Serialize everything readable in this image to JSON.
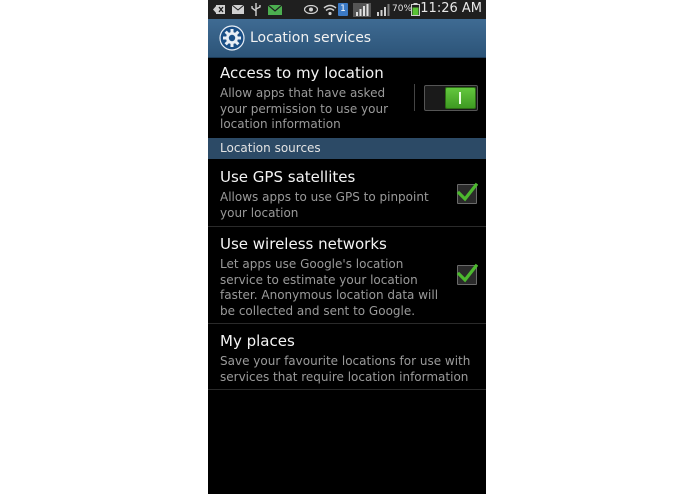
{
  "status_bar": {
    "battery_percent": "70%",
    "time": "11:26 AM",
    "icons": [
      "back-icon",
      "email-icon",
      "usb-icon",
      "gmail-icon",
      "eye-icon",
      "wifi-icon",
      "sim-badge-icon",
      "signal-icon",
      "signal-icon-2",
      "battery-icon"
    ],
    "sim_badge": "1"
  },
  "title_bar": {
    "title": "Location services",
    "icon": "gear-icon"
  },
  "access": {
    "title": "Access to my location",
    "summary": "Allow apps that have asked your permission to use your location information",
    "enabled": true
  },
  "section": {
    "label": "Location sources"
  },
  "gps": {
    "title": "Use GPS satellites",
    "summary": "Allows apps to use GPS to pinpoint your location",
    "checked": true
  },
  "wireless": {
    "title": "Use wireless networks",
    "summary": "Let apps use Google's location service to estimate your location faster. Anonymous location data will be collected and sent to Google.",
    "checked": true
  },
  "places": {
    "title": "My places",
    "summary": "Save your favourite locations for use with services that require location information"
  },
  "colors": {
    "accent_green": "#4cb82e",
    "title_bar": "#3a6690",
    "section_header": "#2c4a66"
  }
}
